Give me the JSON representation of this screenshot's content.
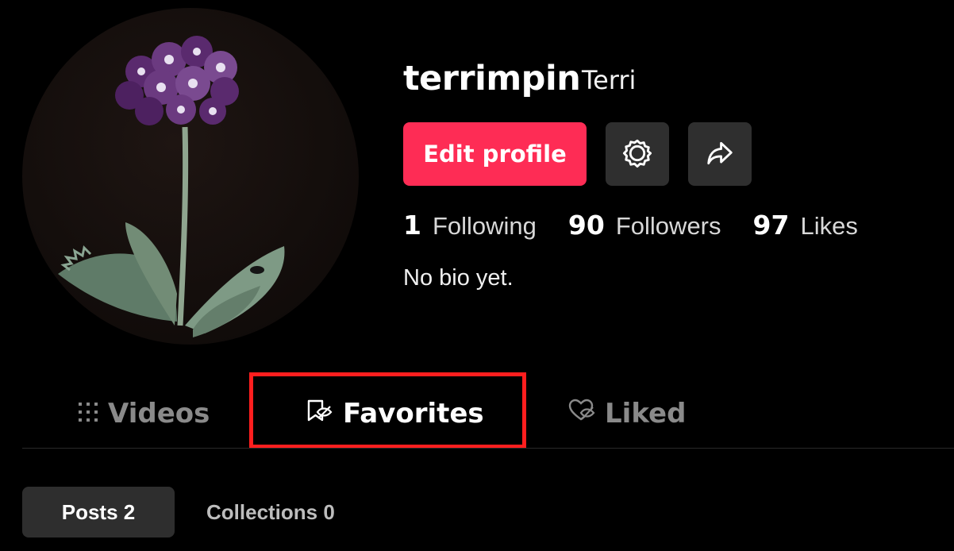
{
  "profile": {
    "username": "terrimpin",
    "nickname": "Terri",
    "bio": "No bio yet.",
    "avatar_icon": "primrose-flower-illustration"
  },
  "actions": {
    "edit_label": "Edit profile",
    "settings_icon": "gear-icon",
    "share_icon": "share-arrow-icon",
    "accent_color": "#fe2c55"
  },
  "stats": [
    {
      "value": "1",
      "label": "Following"
    },
    {
      "value": "90",
      "label": "Followers"
    },
    {
      "value": "97",
      "label": "Likes"
    }
  ],
  "tabs": [
    {
      "label": "Videos",
      "icon": "grid-icon",
      "active": false
    },
    {
      "label": "Favorites",
      "icon": "bookmark-icon",
      "active": true
    },
    {
      "label": "Liked",
      "icon": "heart-icon",
      "active": false
    }
  ],
  "subtabs": {
    "posts": "Posts 2",
    "collections": "Collections 0"
  },
  "highlight_color": "#ff1e1e"
}
